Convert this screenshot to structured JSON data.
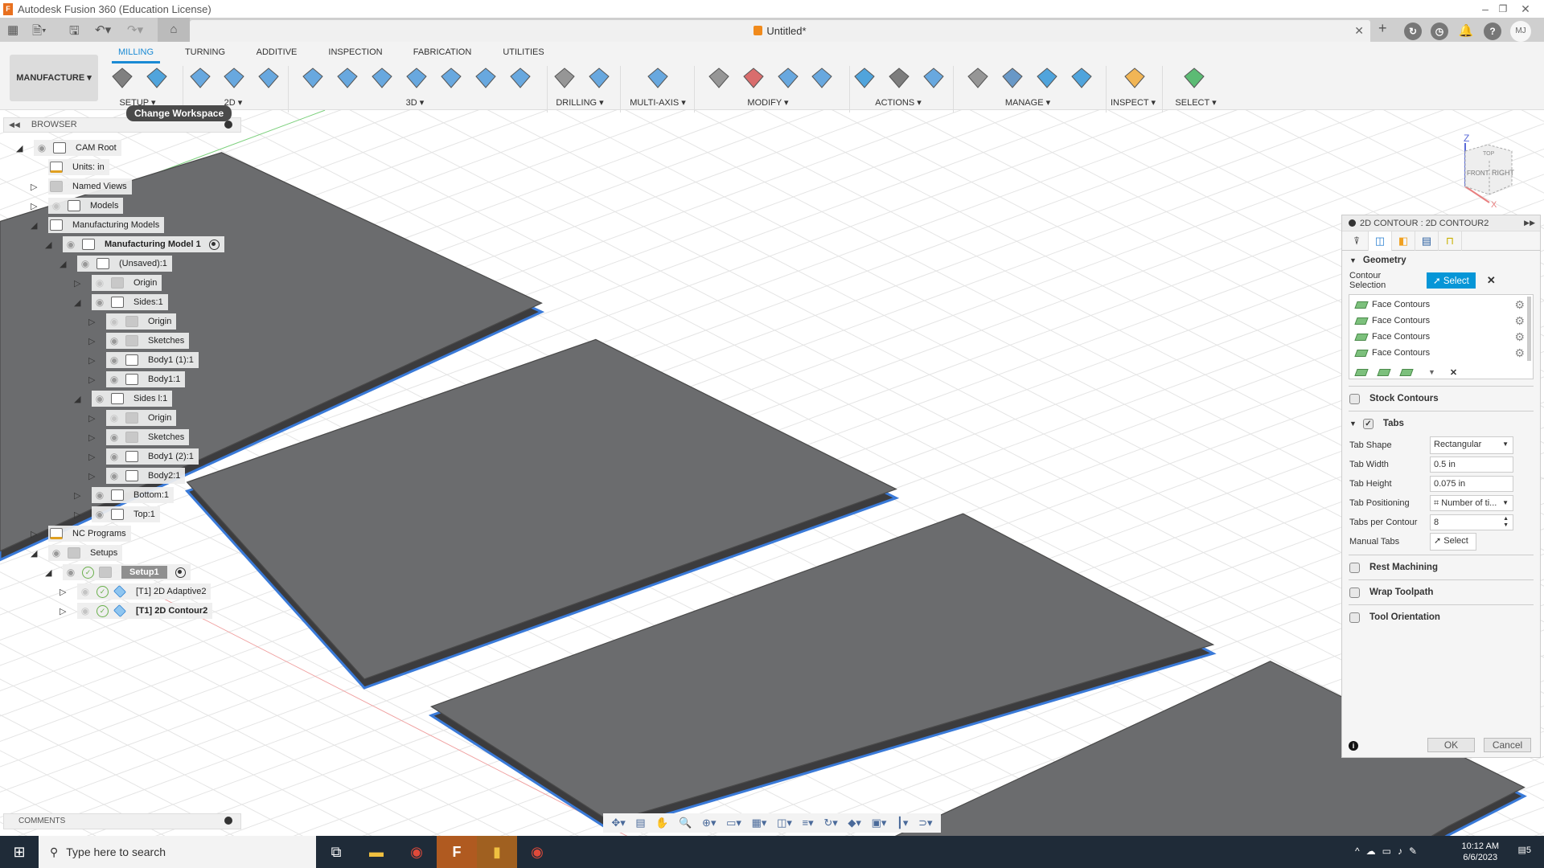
{
  "window": {
    "title": "Autodesk Fusion 360 (Education License)",
    "doc_title": "Untitled*",
    "user_initials": "MJ"
  },
  "ribbon": {
    "workspace": "MANUFACTURE ▾",
    "tabs": [
      "MILLING",
      "TURNING",
      "ADDITIVE",
      "INSPECTION",
      "FABRICATION",
      "UTILITIES"
    ],
    "groups": [
      "SETUP ▾",
      "2D ▾",
      "3D ▾",
      "DRILLING ▾",
      "MULTI-AXIS ▾",
      "MODIFY ▾",
      "ACTIONS ▾",
      "MANAGE ▾",
      "INSPECT ▾",
      "SELECT ▾"
    ],
    "tooltip": "Change Workspace",
    "tools": [
      {
        "name": "new-setup-icon",
        "color": "#5a5a5a"
      },
      {
        "name": "nc-program-icon",
        "color": "#1a8ad4"
      },
      {
        "name": "2d-adaptive-icon",
        "color": "#3a8fd8"
      },
      {
        "name": "2d-pocket-icon",
        "color": "#3a8fd8"
      },
      {
        "name": "2d-contour-icon",
        "color": "#3a8fd8"
      },
      {
        "name": "3d-adaptive-icon",
        "color": "#3a8fd8"
      },
      {
        "name": "3d-pocket-icon",
        "color": "#3a8fd8"
      },
      {
        "name": "steep-shallow-icon",
        "color": "#3a8fd8"
      },
      {
        "name": "parallel-icon",
        "color": "#3a8fd8"
      },
      {
        "name": "contour-3d-icon",
        "color": "#3a8fd8"
      },
      {
        "name": "scallop-icon",
        "color": "#3a8fd8"
      },
      {
        "name": "spiral-icon",
        "color": "#3a8fd8"
      },
      {
        "name": "drill-icon",
        "color": "#777777"
      },
      {
        "name": "hole-recognition-icon",
        "color": "#3a8fd8"
      },
      {
        "name": "multi-axis-icon",
        "color": "#3a8fd8"
      },
      {
        "name": "trim-icon",
        "color": "#777777"
      },
      {
        "name": "delete-toolpath-icon",
        "color": "#d04040"
      },
      {
        "name": "tool-icon",
        "color": "#3a8fd8"
      },
      {
        "name": "pattern-icon",
        "color": "#3a8fd8"
      },
      {
        "name": "simulate-g1g2-icon",
        "color": "#1a8ad4"
      },
      {
        "name": "setup-sheet-icon",
        "color": "#555555"
      },
      {
        "name": "post-process-icon",
        "color": "#3a8fd8"
      },
      {
        "name": "tool-library-icon",
        "color": "#777777"
      },
      {
        "name": "machine-library-icon",
        "color": "#3a7ab8"
      },
      {
        "name": "post-library-icon",
        "color": "#1a8ad4"
      },
      {
        "name": "template-library-icon",
        "color": "#1a8ad4"
      },
      {
        "name": "measure-icon",
        "color": "#f0a020"
      },
      {
        "name": "select-window-icon",
        "color": "#2aa84a"
      }
    ]
  },
  "browser": {
    "title": "BROWSER",
    "rows": [
      {
        "label": "CAM Root",
        "level": 0,
        "arrow": "open",
        "eye": "on",
        "icon": "comp"
      },
      {
        "label": "Units: in",
        "level": 1,
        "arrow": "none",
        "eye": "none",
        "icon": "doc"
      },
      {
        "label": "Named Views",
        "level": 1,
        "arrow": "closed",
        "eye": "none",
        "icon": "folder"
      },
      {
        "label": "Models",
        "level": 1,
        "arrow": "closed",
        "eye": "off",
        "icon": "comp"
      },
      {
        "label": "Manufacturing Models",
        "level": 1,
        "arrow": "open",
        "eye": "none",
        "icon": "comp"
      },
      {
        "label": "Manufacturing Model 1",
        "level": 2,
        "arrow": "open",
        "eye": "on",
        "icon": "comp",
        "bold": true,
        "target": true
      },
      {
        "label": "(Unsaved):1",
        "level": 3,
        "arrow": "open",
        "eye": "on",
        "icon": "comp"
      },
      {
        "label": "Origin",
        "level": 4,
        "arrow": "closed",
        "eye": "off",
        "icon": "folder"
      },
      {
        "label": "Sides:1",
        "level": 4,
        "arrow": "open",
        "eye": "on",
        "icon": "comp"
      },
      {
        "label": "Origin",
        "level": 5,
        "arrow": "closed",
        "eye": "off",
        "icon": "folder"
      },
      {
        "label": "Sketches",
        "level": 5,
        "arrow": "closed",
        "eye": "on",
        "icon": "folder"
      },
      {
        "label": "Body1 (1):1",
        "level": 5,
        "arrow": "closed",
        "eye": "on",
        "icon": "body"
      },
      {
        "label": "Body1:1",
        "level": 5,
        "arrow": "closed",
        "eye": "on",
        "icon": "body"
      },
      {
        "label": "Sides l:1",
        "level": 4,
        "arrow": "open",
        "eye": "on",
        "icon": "comp"
      },
      {
        "label": "Origin",
        "level": 5,
        "arrow": "closed",
        "eye": "off",
        "icon": "folder"
      },
      {
        "label": "Sketches",
        "level": 5,
        "arrow": "closed",
        "eye": "on",
        "icon": "folder"
      },
      {
        "label": "Body1 (2):1",
        "level": 5,
        "arrow": "closed",
        "eye": "on",
        "icon": "body"
      },
      {
        "label": "Body2:1",
        "level": 5,
        "arrow": "closed",
        "eye": "on",
        "icon": "body"
      },
      {
        "label": "Bottom:1",
        "level": 4,
        "arrow": "closed",
        "eye": "on",
        "icon": "body"
      },
      {
        "label": "Top:1",
        "level": 4,
        "arrow": "closed",
        "eye": "on",
        "icon": "body"
      },
      {
        "label": "NC Programs",
        "level": 1,
        "arrow": "closed",
        "eye": "none",
        "icon": "doc"
      },
      {
        "label": "Setups",
        "level": 1,
        "arrow": "open",
        "eye": "on",
        "icon": "folder"
      },
      {
        "label": "Setup1",
        "level": 2,
        "arrow": "open",
        "eye": "on",
        "check": true,
        "icon": "folder",
        "selected": true,
        "target": true
      },
      {
        "label": "[T1] 2D Adaptive2",
        "level": 3,
        "arrow": "closed",
        "eye": "off",
        "check": true,
        "icon": "op"
      },
      {
        "label": "[T1] 2D Contour2",
        "level": 3,
        "arrow": "closed",
        "eye": "off",
        "check": true,
        "icon": "op",
        "bold": true
      }
    ]
  },
  "comments": {
    "title": "COMMENTS"
  },
  "viewcube": {
    "top": "TOP",
    "front": "FRONT",
    "right": "RIGHT",
    "z": "Z",
    "x": "X"
  },
  "panel": {
    "title": "2D CONTOUR : 2D CONTOUR2",
    "geometry": "Geometry",
    "contour_selection": "Contour Selection",
    "select": "Select",
    "contours": [
      "Face Contours",
      "Face Contours",
      "Face Contours",
      "Face Contours"
    ],
    "stock_contours": "Stock Contours",
    "tabs_label": "Tabs",
    "fields": {
      "tab_shape": {
        "label": "Tab Shape",
        "value": "Rectangular"
      },
      "tab_width": {
        "label": "Tab Width",
        "value": "0.5 in"
      },
      "tab_height": {
        "label": "Tab Height",
        "value": "0.075 in"
      },
      "tab_positioning": {
        "label": "Tab Positioning",
        "value": "Number of ti..."
      },
      "tabs_per_contour": {
        "label": "Tabs per Contour",
        "value": "8"
      },
      "manual_tabs": {
        "label": "Manual Tabs",
        "value": "Select"
      }
    },
    "rest_machining": "Rest Machining",
    "wrap_toolpath": "Wrap Toolpath",
    "tool_orientation": "Tool Orientation",
    "ok": "OK",
    "cancel": "Cancel"
  },
  "taskbar": {
    "search_placeholder": "Type here to search",
    "time": "10:12 AM",
    "date": "6/6/2023",
    "notifications": "5"
  }
}
